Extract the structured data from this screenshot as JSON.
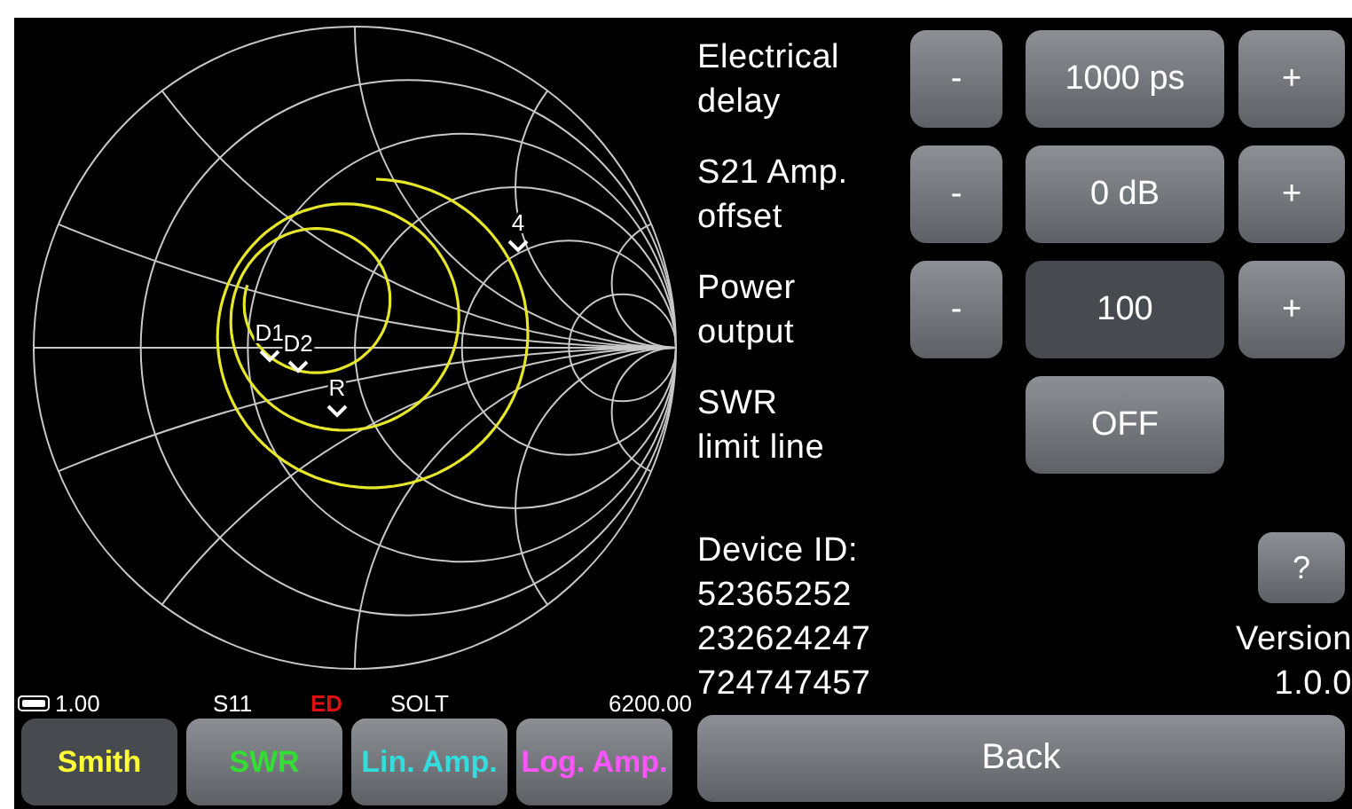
{
  "chart": {
    "markers": [
      {
        "label": "4"
      },
      {
        "label": "D1"
      },
      {
        "label": "D2"
      },
      {
        "label": "R"
      }
    ]
  },
  "status_bar": {
    "battery_reading": "1.00",
    "parameter": "S11",
    "flag": "ED",
    "calibration": "SOLT",
    "frequency": "6200.00"
  },
  "tabs": [
    {
      "label": "Smith",
      "color": "#ffff33",
      "selected": true
    },
    {
      "label": "SWR",
      "color": "#33dd33",
      "selected": false
    },
    {
      "label": "Lin. Amp.",
      "color": "#33dddd",
      "selected": false
    },
    {
      "label": "Log. Amp.",
      "color": "#ff55ff",
      "selected": false
    }
  ],
  "settings": [
    {
      "kind": "stepper",
      "label": "Electrical\ndelay",
      "minus": "-",
      "value": "1000 ps",
      "plus": "+",
      "selected": false
    },
    {
      "kind": "stepper",
      "label": "S21 Amp.\noffset",
      "minus": "-",
      "value": "0 dB",
      "plus": "+",
      "selected": false
    },
    {
      "kind": "stepper",
      "label": "Power\noutput",
      "minus": "-",
      "value": "100",
      "plus": "+",
      "selected": true
    },
    {
      "kind": "toggle",
      "label": "SWR\nlimit line",
      "value": "OFF",
      "selected": false
    }
  ],
  "device": {
    "label": "Device ID:",
    "lines": [
      "52365252",
      "232624247",
      "724747457"
    ]
  },
  "help_button": "?",
  "version": {
    "label": "Version",
    "value": "1.0.0"
  },
  "back_button": "Back"
}
